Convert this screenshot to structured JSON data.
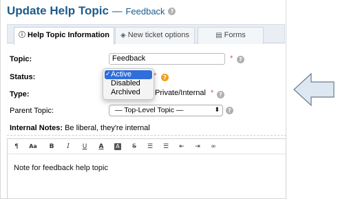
{
  "title": {
    "main": "Update Help Topic",
    "dash": "—",
    "sub": "Feedback"
  },
  "tabs": [
    {
      "label": "Help Topic Information",
      "icon": "info-circle-icon",
      "active": true
    },
    {
      "label": "New ticket options",
      "icon": "tag-icon",
      "active": false
    },
    {
      "label": "Forms",
      "icon": "forms-icon",
      "active": false
    }
  ],
  "form": {
    "topic_label": "Topic:",
    "topic_value": "Feedback",
    "status_label": "Status:",
    "type_label": "Type:",
    "type_value_visible": "Private/Internal",
    "parent_label": "Parent Topic:",
    "parent_value": "— Top-Level Topic —",
    "required_mark": "*",
    "help_glyph": "?"
  },
  "status_dropdown": {
    "options": [
      "Active",
      "Disabled",
      "Archived"
    ],
    "selected": "Active",
    "check": "✓"
  },
  "notes": {
    "label_bold": "Internal Notes:",
    "label_rest": " Be liberal, they're internal",
    "text": "Note for feedback help topic"
  },
  "toolbar_icons": [
    "paragraph-icon",
    "font-size-icon",
    "bold-icon",
    "italic-icon",
    "underline-icon",
    "text-color-icon",
    "bg-color-icon",
    "strikethrough-icon",
    "unordered-list-icon",
    "ordered-list-icon",
    "outdent-icon",
    "indent-icon",
    "link-icon"
  ],
  "toolbar_glyphs": {
    "paragraph": "¶",
    "fontsize": "Aa",
    "bold": "B",
    "italic": "I",
    "underline": "U",
    "color": "A",
    "bgcolor": "A",
    "strike": "S",
    "ul": "☰",
    "ol": "☰",
    "outdent": "⇤",
    "indent": "⇥",
    "link": "∞"
  },
  "colors": {
    "title": "#1c5b8c",
    "required": "#d9534f",
    "selected": "#2f6edb",
    "arrow_fill": "#dde7f2",
    "arrow_stroke": "#6b7a8c"
  }
}
